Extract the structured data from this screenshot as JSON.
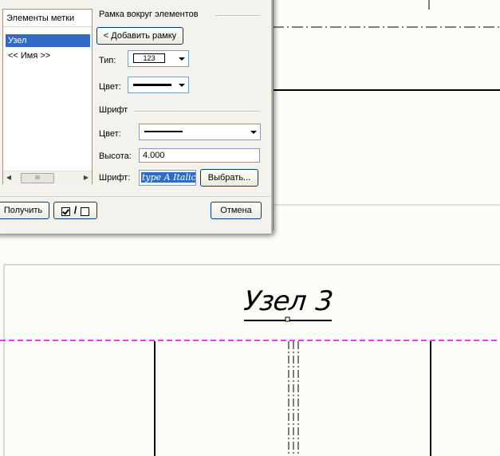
{
  "dialog": {
    "elements_group_title": "Элементы метки",
    "elements_items": [
      {
        "label": "Узел",
        "selected": true
      },
      {
        "label": "<< Имя >>",
        "selected": false
      }
    ],
    "frame_group_title": "Рамка вокруг элементов",
    "add_frame_button": "< Добавить рамку",
    "type_label": "Тип:",
    "type_sample": "123",
    "frame_color_label": "Цвет:",
    "font_group_title": "Шрифт",
    "font_color_label": "Цвет:",
    "height_label": "Высота:",
    "height_value": "4.000",
    "font_label": "Шрифт:",
    "font_value": "type A Italic",
    "choose_button": "Выбрать...",
    "get_button": "Получить",
    "toggle_slash": "/",
    "cancel_button": "Отмена",
    "scroll_thumb": "III"
  },
  "drawing": {
    "title_word": "Узел",
    "title_number": "3",
    "accent_color": "#e000e0"
  }
}
